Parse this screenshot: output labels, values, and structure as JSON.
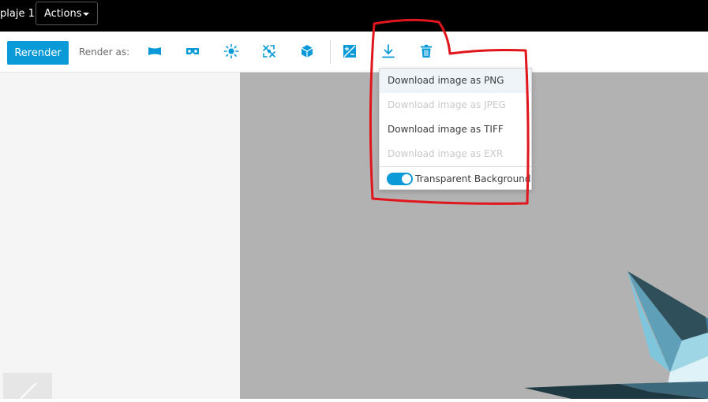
{
  "header": {
    "title": "plaje 1",
    "actions_label": "Actions"
  },
  "toolbar": {
    "rerender_label": "Rerender",
    "render_as_label": "Render as:",
    "icons": [
      "panorama-icon",
      "vr-headset-icon",
      "sun-icon",
      "illuminance-icon",
      "cube-scene-icon",
      "exposure-icon",
      "download-icon",
      "trash-icon"
    ]
  },
  "download_menu": {
    "items": [
      {
        "label": "Download image as PNG",
        "enabled": true,
        "highlighted": true
      },
      {
        "label": "Download image as JPEG",
        "enabled": false
      },
      {
        "label": "Download image as TIFF",
        "enabled": true
      },
      {
        "label": "Download image as EXR",
        "enabled": false
      }
    ],
    "transparent_background_label": "Transparent Background",
    "transparent_background_on": true
  },
  "colors": {
    "accent": "#0a9ad8",
    "annotation": "#e0161c",
    "canvas": "#b2b2b2"
  }
}
